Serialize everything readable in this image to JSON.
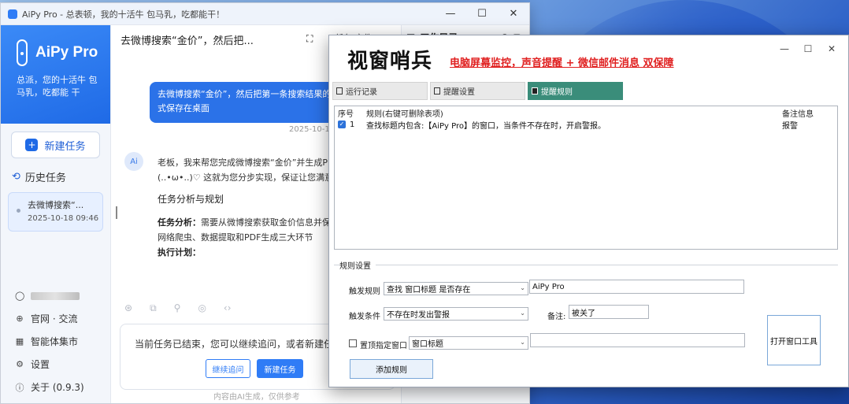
{
  "aipy": {
    "window_title": "AiPy Pro - 总表顿，我的十活牛 包马乳，吃都能干！",
    "window_controls": [
      "—",
      "☐",
      "✕"
    ],
    "brand": {
      "name": "AiPy Pro",
      "slogan": "总派，您的十活牛 包马乳，吃都能 干"
    },
    "new_task_label": "新建任务",
    "history_label": "历史任务",
    "history_items": [
      {
        "title": "去微博搜索“...",
        "date": "2025-10-18 09:46"
      }
    ],
    "menu": [
      {
        "label": "",
        "icon": "user-icon"
      },
      {
        "label": "官网 · 交流",
        "icon": "globe-icon"
      },
      {
        "label": "智能体集市",
        "icon": "grid-icon"
      },
      {
        "label": "设置",
        "icon": "gear-icon"
      },
      {
        "label": "关于 (0.9.3)",
        "icon": "info-icon"
      }
    ],
    "chat": {
      "title": "去微博搜索“金价”，然后把...",
      "header_tabs": "任务  文件",
      "user_message": "去微博搜索“金价”，然后把第一条搜索结果的网页转为PDF形式保存在桌面",
      "message_time": "2025-10-18",
      "avatar": "Ai",
      "answer_intro": "老板，我来帮您完成微博搜索“金价”并生成PDF的任务啦(..•ω•..)♡ 这就为您分步实现，保证让您满意！",
      "answer_heading": "任务分析与规划",
      "analysis_label": "任务分析：",
      "analysis_text": "需要从微博搜索获取金价信息并保存为PDF，涉及网络爬虫、数据提取和PDF生成三大环节",
      "plan_label": "执行计划：",
      "input_status": "当前任务已结束，您可以继续追问，或者新建任务",
      "continue_label": "继续追问",
      "new_task_label": "新建任务",
      "disclaimer": "内容由AI生成，仅供参考"
    },
    "toc_title": "工作目录"
  },
  "sentinel": {
    "title": "视窗哨兵",
    "subtitle": "电脑屏幕监控，声音提醒 + 微信邮件消息 双保障",
    "window_controls": [
      "—",
      "☐",
      "✕"
    ],
    "tabs": [
      {
        "label": "运行记录",
        "active": false
      },
      {
        "label": "提醒设置",
        "active": false
      },
      {
        "label": "提醒规则",
        "active": true
      }
    ],
    "table": {
      "headers": [
        "序号",
        "规则(右键可删除表项)",
        "备注信息"
      ],
      "rows": [
        {
          "index": "1",
          "rule": "查找标题内包含:【AiPy Pro】的窗口，当条件不存在时，开启警报。",
          "note": "报警",
          "checked": true
        }
      ]
    },
    "group_label": "规则设置",
    "trigger_rule_label": "触发规则",
    "trigger_rule_value": "查找 窗口标题 是否存在",
    "trigger_rule_text": "AiPy Pro",
    "trigger_cond_label": "触发条件",
    "trigger_cond_value": "不存在时发出警报",
    "note_label": "备注:",
    "note_value": "被关了",
    "bind_window_label": "置顶指定窗口",
    "bind_window_value": "窗口标题",
    "bind_window_text": "",
    "add_rule_label": "添加规则",
    "open_tool_label": "打开窗口工具",
    "accent_color": "#3a8d7a",
    "subtitle_color": "#e02020"
  }
}
